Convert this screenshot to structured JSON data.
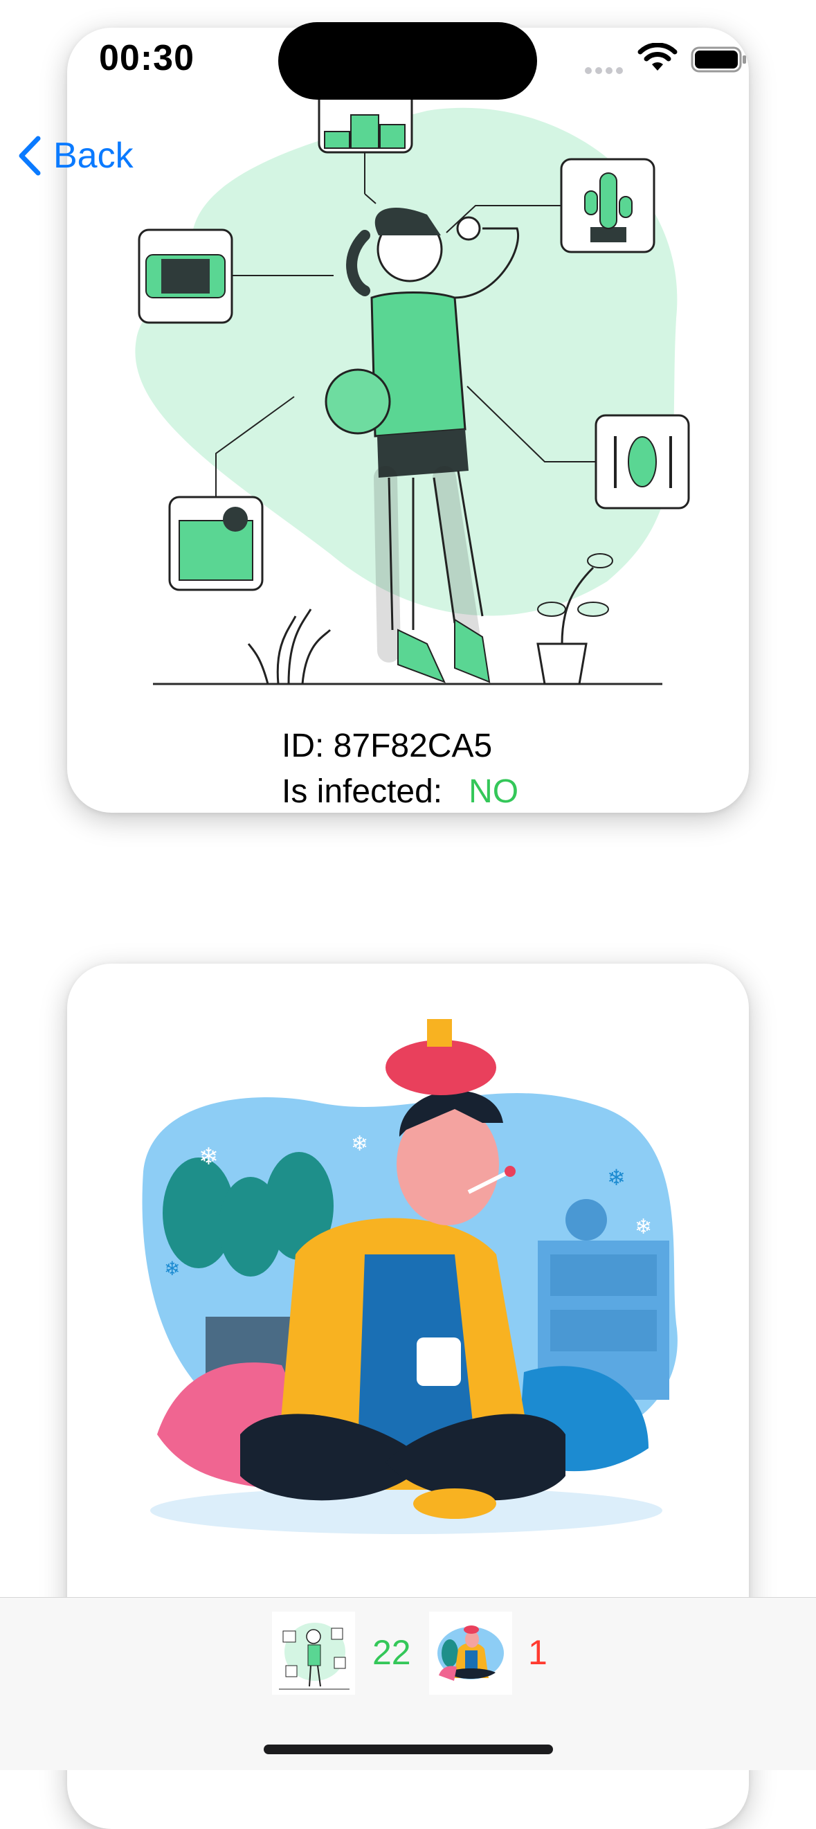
{
  "status_bar": {
    "time": "00:30",
    "icons": [
      "signal-dots-icon",
      "wifi-icon",
      "battery-icon"
    ]
  },
  "nav": {
    "back_label": "Back",
    "back_icon": "chevron-left-icon"
  },
  "cards": [
    {
      "illustration": "healthy-person-illustration",
      "id_label": "ID: 87F82CA5",
      "infected_label": "Is infected:",
      "infected_value": "NO"
    },
    {
      "illustration": "sick-person-illustration"
    }
  ],
  "tab_bar": {
    "healthy_count": "22",
    "sick_count": "1"
  },
  "colors": {
    "accent": "#0a7aff",
    "healthy": "#34c759",
    "sick": "#ff3b30",
    "mint": "#d4f5e3",
    "green": "#5ad693"
  }
}
